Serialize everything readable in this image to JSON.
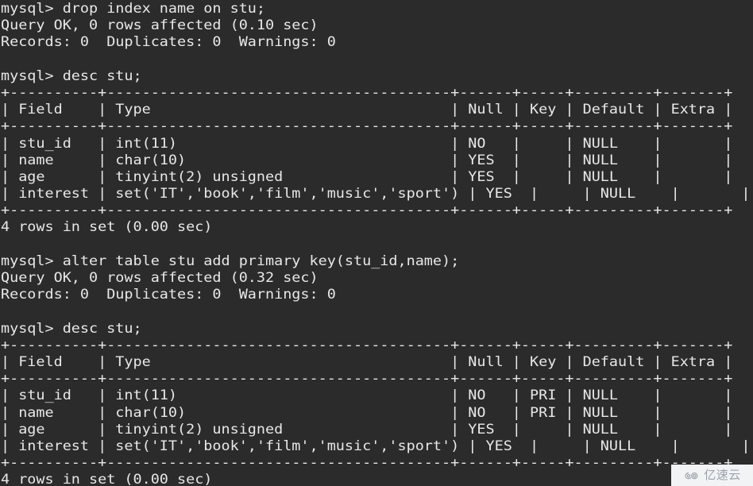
{
  "terminal": {
    "background_color": "#2b2b2b",
    "text_color": "#e8e8e8",
    "prompt": "mysql>",
    "lines": [
      "mysql> drop index name on stu;",
      "Query OK, 0 rows affected (0.10 sec)",
      "Records: 0  Duplicates: 0  Warnings: 0",
      "",
      "mysql> desc stu;",
      "+----------+---------------------------------------+------+-----+---------+-------+",
      "| Field    | Type                                  | Null | Key | Default | Extra |",
      "+----------+---------------------------------------+------+-----+---------+-------+",
      "| stu_id   | int(11)                               | NO   |     | NULL    |       |",
      "| name     | char(10)                              | YES  |     | NULL    |       |",
      "| age      | tinyint(2) unsigned                   | YES  |     | NULL    |       |",
      "| interest | set('IT','book','film','music','sport') | YES  |     | NULL    |       |",
      "+----------+---------------------------------------+------+-----+---------+-------+",
      "4 rows in set (0.00 sec)",
      "",
      "mysql> alter table stu add primary key(stu_id,name);",
      "Query OK, 0 rows affected (0.32 sec)",
      "Records: 0  Duplicates: 0  Warnings: 0",
      "",
      "mysql> desc stu;",
      "+----------+---------------------------------------+------+-----+---------+-------+",
      "| Field    | Type                                  | Null | Key | Default | Extra |",
      "+----------+---------------------------------------+------+-----+---------+-------+",
      "| stu_id   | int(11)                               | NO   | PRI | NULL    |       |",
      "| name     | char(10)                              | NO   | PRI | NULL    |       |",
      "| age      | tinyint(2) unsigned                   | YES  |     | NULL    |       |",
      "| interest | set('IT','book','film','music','sport') | YES  |     | NULL    |       |",
      "+----------+---------------------------------------+------+-----+---------+-------+",
      "4 rows in set (0.00 sec)"
    ],
    "commands": [
      "drop index name on stu;",
      "desc stu;",
      "alter table stu add primary key(stu_id,name);",
      "desc stu;"
    ],
    "statuses": [
      "Query OK, 0 rows affected (0.10 sec)",
      "Records: 0  Duplicates: 0  Warnings: 0",
      "4 rows in set (0.00 sec)",
      "Query OK, 0 rows affected (0.32 sec)",
      "Records: 0  Duplicates: 0  Warnings: 0",
      "4 rows in set (0.00 sec)"
    ],
    "tables": [
      {
        "headers": [
          "Field",
          "Type",
          "Null",
          "Key",
          "Default",
          "Extra"
        ],
        "rows": [
          [
            "stu_id",
            "int(11)",
            "NO",
            "",
            "NULL",
            ""
          ],
          [
            "name",
            "char(10)",
            "YES",
            "",
            "NULL",
            ""
          ],
          [
            "age",
            "tinyint(2) unsigned",
            "YES",
            "",
            "NULL",
            ""
          ],
          [
            "interest",
            "set('IT','book','film','music','sport')",
            "YES",
            "",
            "NULL",
            ""
          ]
        ],
        "row_count_label": "4 rows in set (0.00 sec)"
      },
      {
        "headers": [
          "Field",
          "Type",
          "Null",
          "Key",
          "Default",
          "Extra"
        ],
        "rows": [
          [
            "stu_id",
            "int(11)",
            "NO",
            "PRI",
            "NULL",
            ""
          ],
          [
            "name",
            "char(10)",
            "NO",
            "PRI",
            "NULL",
            ""
          ],
          [
            "age",
            "tinyint(2) unsigned",
            "YES",
            "",
            "NULL",
            ""
          ],
          [
            "interest",
            "set('IT','book','film','music','sport')",
            "YES",
            "",
            "NULL",
            ""
          ]
        ],
        "row_count_label": "4 rows in set (0.00 sec)"
      }
    ]
  },
  "watermark": {
    "text": "亿速云",
    "logo_icon": "cloud-icon",
    "text_color": "#9aa3ad",
    "background_color": "#f2f3f5"
  }
}
